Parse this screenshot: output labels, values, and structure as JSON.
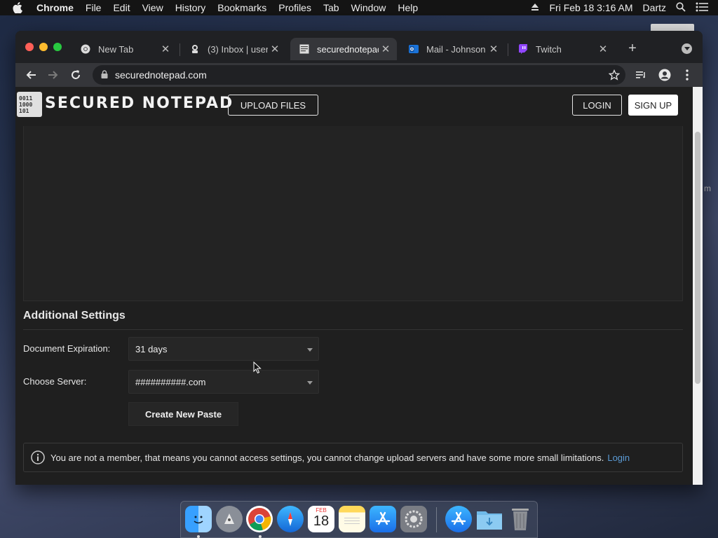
{
  "menubar": {
    "app_name": "Chrome",
    "items": [
      "File",
      "Edit",
      "View",
      "History",
      "Bookmarks",
      "Profiles",
      "Tab",
      "Window",
      "Help"
    ],
    "datetime": "Fri Feb 18  3:16 AM",
    "user": "Dartz"
  },
  "tabs": [
    {
      "title": "New Tab",
      "icon": "chrome-icon"
    },
    {
      "title": "(3) Inbox | user",
      "icon": "mail-icon"
    },
    {
      "title": "securednotepad",
      "icon": "notepad-icon",
      "active": true
    },
    {
      "title": "Mail - Johnson",
      "icon": "outlook-icon"
    },
    {
      "title": "Twitch",
      "icon": "twitch-icon"
    }
  ],
  "browser": {
    "url": "securednotepad.com"
  },
  "site": {
    "logo_bits": [
      "0011",
      "1000",
      "101"
    ],
    "logo_text": "SECURED NOTEPAD",
    "upload_label": "UPLOAD FILES",
    "login_label": "LOGIN",
    "signup_label": "SIGN UP"
  },
  "settings": {
    "title": "Additional Settings",
    "expiration_label": "Document Expiration:",
    "expiration_value": "31 days",
    "server_label": "Choose Server:",
    "server_value": "##########.com",
    "create_button": "Create New Paste"
  },
  "notice": {
    "text": "You are not a member, that means you cannot access settings, you cannot change upload servers and have some more small limitations.",
    "link": "Login"
  },
  "desktop": {
    "edge_text": "m"
  },
  "dock": {
    "calendar_month": "FEB",
    "calendar_day": "18",
    "icons": [
      "finder-icon",
      "launchpad-icon",
      "chrome-icon",
      "safari-icon",
      "calendar-icon",
      "notes-icon",
      "app-store-icon",
      "system-preferences-icon",
      "app-store-icon",
      "downloads-folder-icon",
      "trash-icon"
    ]
  },
  "colors": {
    "page_background": "#1f1f1f",
    "link": "#5b9bd5",
    "traffic_red": "#ff5f57",
    "traffic_yellow": "#febc2e",
    "traffic_green": "#28c840"
  }
}
